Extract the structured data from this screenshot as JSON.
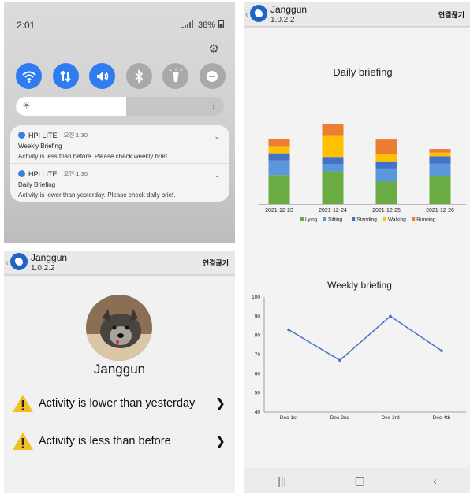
{
  "shade": {
    "time": "2:01",
    "battery": "38%",
    "brightness_level": 0.53,
    "quick_settings": [
      {
        "icon": "wifi-icon",
        "state": "on"
      },
      {
        "icon": "data-transfer-icon",
        "state": "on"
      },
      {
        "icon": "sound-icon",
        "state": "on"
      },
      {
        "icon": "bluetooth-icon",
        "state": "off"
      },
      {
        "icon": "flashlight-icon",
        "state": "off"
      },
      {
        "icon": "do-not-disturb-icon",
        "state": "off"
      }
    ],
    "notifications": [
      {
        "app": "HPI LITE",
        "time": "오전 1:30",
        "title": "Weekly Briefing",
        "body": "Activity is less than before. Please check weekly brief."
      },
      {
        "app": "HPI LITE",
        "time": "오전 1:30",
        "title": "Daily Briefing",
        "body": "Activity is lower than yesterday. Please check daily brief."
      }
    ]
  },
  "appbar": {
    "name": "Janggun",
    "version": "1.0.2.2",
    "connect": "연결끊기"
  },
  "profile": {
    "pet_name": "Janggun",
    "alerts": [
      {
        "text": "Activity is lower than yesterday"
      },
      {
        "text": "Activity is less than before"
      }
    ]
  },
  "colors": {
    "accent": "#2f7bf0",
    "lying": "#6aab44",
    "sitting": "#5b98db",
    "standing": "#4472c4",
    "walking": "#ffc000",
    "running": "#ed7d31",
    "line": "#4472c4"
  },
  "chart_data": [
    {
      "type": "bar",
      "stacked": true,
      "title": "Daily briefing",
      "categories": [
        "2021-12-23",
        "2021-12-24",
        "2021-12-25",
        "2021-12-26"
      ],
      "series": [
        {
          "name": "Lying",
          "values": [
            40,
            45,
            31,
            39
          ]
        },
        {
          "name": "Sitting",
          "values": [
            20,
            10,
            18,
            17
          ]
        },
        {
          "name": "Standing",
          "values": [
            10,
            10,
            10,
            10
          ]
        },
        {
          "name": "Walking",
          "values": [
            10,
            30,
            10,
            5
          ]
        },
        {
          "name": "Running",
          "values": [
            10,
            15,
            20,
            5
          ]
        }
      ],
      "legend": "bottom"
    },
    {
      "type": "line",
      "title": "Weekly briefing",
      "categories": [
        "Dec-1st",
        "Dec-2nd",
        "Dec-3rd",
        "Dec-4th"
      ],
      "values": [
        83,
        67,
        90,
        72
      ],
      "y_ticks": [
        "100",
        "90",
        "80",
        "70",
        "60",
        "50",
        "40"
      ],
      "ylim": [
        40,
        100
      ]
    }
  ]
}
